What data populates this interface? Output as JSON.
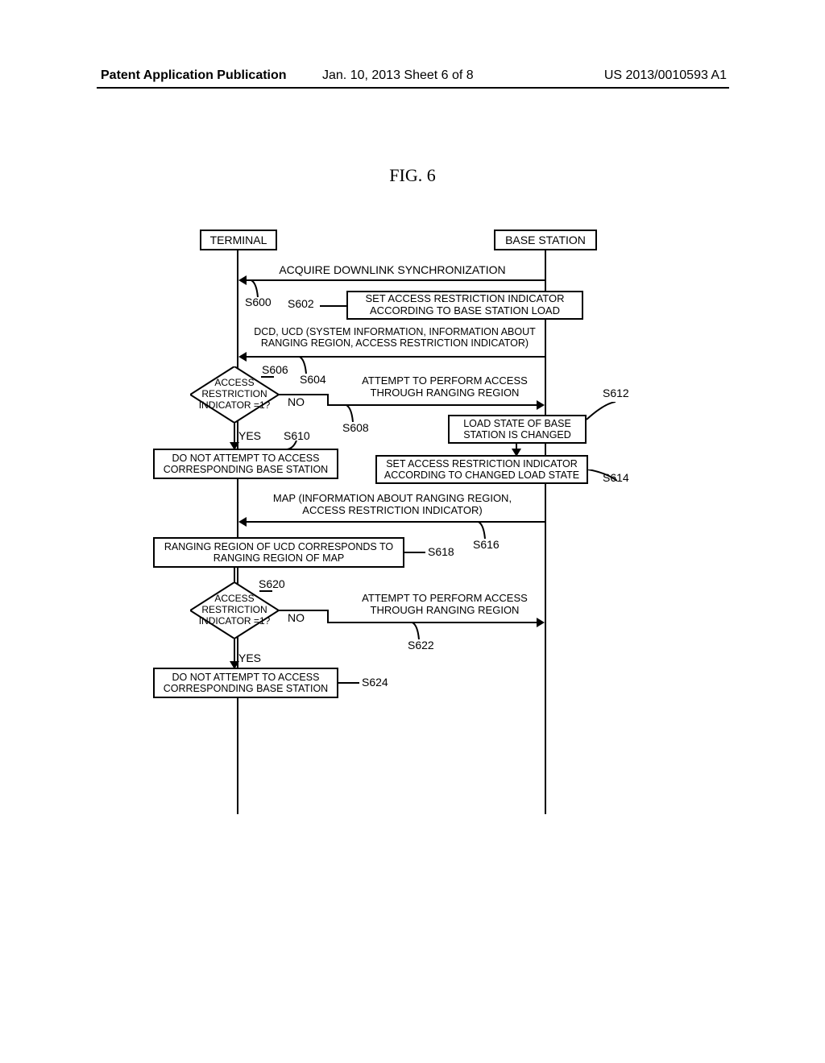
{
  "header": {
    "left": "Patent Application Publication",
    "center": "Jan. 10, 2013  Sheet 6 of 8",
    "right": "US 2013/0010593 A1"
  },
  "figure_label": "FIG. 6",
  "entities": {
    "terminal": "TERMINAL",
    "base_station": "BASE STATION"
  },
  "messages": {
    "m1": "ACQUIRE DOWNLINK SYNCHRONIZATION",
    "m2": "DCD, UCD (SYSTEM INFORMATION, INFORMATION ABOUT RANGING REGION, ACCESS RESTRICTION INDICATOR)",
    "m3": "ATTEMPT TO PERFORM ACCESS THROUGH RANGING REGION",
    "m4": "MAP (INFORMATION ABOUT RANGING REGION, ACCESS RESTRICTION INDICATOR)",
    "m5": "ATTEMPT TO PERFORM ACCESS THROUGH RANGING REGION"
  },
  "process_boxes": {
    "p1": "SET ACCESS RESTRICTION INDICATOR ACCORDING TO BASE STATION LOAD",
    "p2": "DO NOT ATTEMPT TO ACCESS CORRESPONDING BASE STATION",
    "p3": "LOAD STATE OF BASE STATION IS CHANGED",
    "p4": "SET ACCESS RESTRICTION INDICATOR ACCORDING TO CHANGED LOAD STATE",
    "p5": "RANGING REGION OF UCD CORRESPONDS TO RANGING REGION OF MAP",
    "p6": "DO NOT ATTEMPT TO ACCESS CORRESPONDING BASE STATION"
  },
  "decisions": {
    "d1": "ACCESS\nRESTRICTION\nINDICATOR =1?",
    "d2": "ACCESS\nRESTRICTION\nINDICATOR =1?"
  },
  "branch_labels": {
    "yes": "YES",
    "no": "NO"
  },
  "step_refs": {
    "s600": "S600",
    "s602": "S602",
    "s604": "S604",
    "s606": "S606",
    "s608": "S608",
    "s610": "S610",
    "s612": "S612",
    "s614": "S614",
    "s616": "S616",
    "s618": "S618",
    "s620": "S620",
    "s622": "S622",
    "s624": "S624"
  }
}
